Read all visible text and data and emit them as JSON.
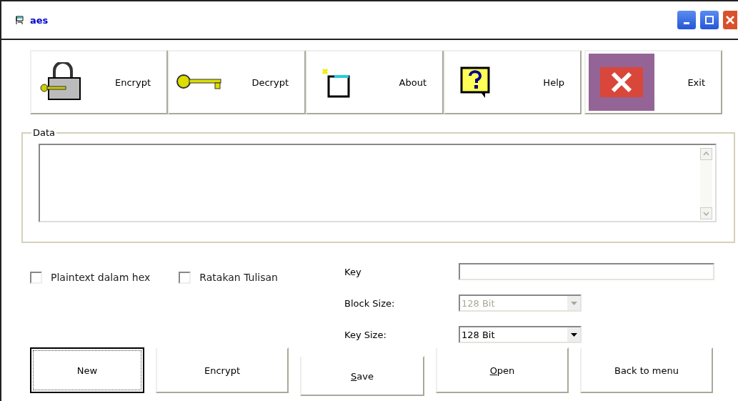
{
  "window": {
    "title": "aes"
  },
  "toolbar": [
    {
      "label": "Encrypt",
      "kind": "lock",
      "selected": false
    },
    {
      "label": "Decrypt",
      "kind": "key",
      "selected": false
    },
    {
      "label": "About",
      "kind": "about",
      "selected": false
    },
    {
      "label": "Help",
      "kind": "help",
      "selected": false
    },
    {
      "label": "Exit",
      "kind": "exit",
      "selected": true
    }
  ],
  "data_group": {
    "label": "Data"
  },
  "options": [
    {
      "label": "Plaintext dalam hex",
      "checked": false
    },
    {
      "label": "Ratakan Tulisan",
      "checked": false
    }
  ],
  "key": {
    "label": "Key"
  },
  "block_size": {
    "label": "Block Size:",
    "value": "128 Bit",
    "disabled": true
  },
  "key_size": {
    "label": "Key Size:",
    "value": "128 Bit",
    "disabled": false
  },
  "buttons": [
    {
      "label": "New",
      "focused": true,
      "mnemonic": false
    },
    {
      "label": "Encrypt",
      "focused": false,
      "mnemonic": false
    },
    {
      "label": "Save",
      "focused": false,
      "mnemonic": true
    },
    {
      "label": "Open",
      "focused": false,
      "mnemonic": true
    },
    {
      "label": "Back to menu",
      "focused": false,
      "mnemonic": false
    }
  ]
}
